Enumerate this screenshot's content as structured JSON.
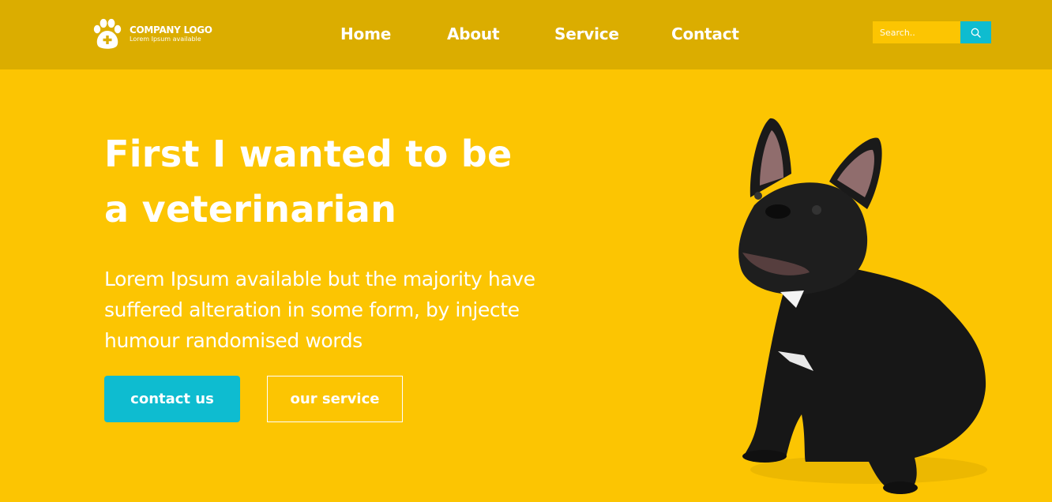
{
  "header": {
    "logo": {
      "title": "COMPANY LOGO",
      "subtitle": "Lorem Ipsum available",
      "icon": "paw-plus-icon"
    },
    "nav": [
      {
        "label": "Home"
      },
      {
        "label": "About"
      },
      {
        "label": "Service"
      },
      {
        "label": "Contact"
      }
    ],
    "search": {
      "placeholder": "Search..",
      "value": "",
      "icon": "search-icon"
    }
  },
  "hero": {
    "title_line1": "First I wanted to be",
    "title_line2": "a veterinarian",
    "text": "Lorem Ipsum available but the majority have suffered alteration in some form, by injecte humour randomised words",
    "primary_button": "contact us",
    "secondary_button": "our service",
    "image": "french-bulldog-photo"
  },
  "colors": {
    "header_bg": "#dbad00",
    "page_bg": "#fcc502",
    "accent": "#0ebcd0",
    "text": "#ffffff"
  }
}
